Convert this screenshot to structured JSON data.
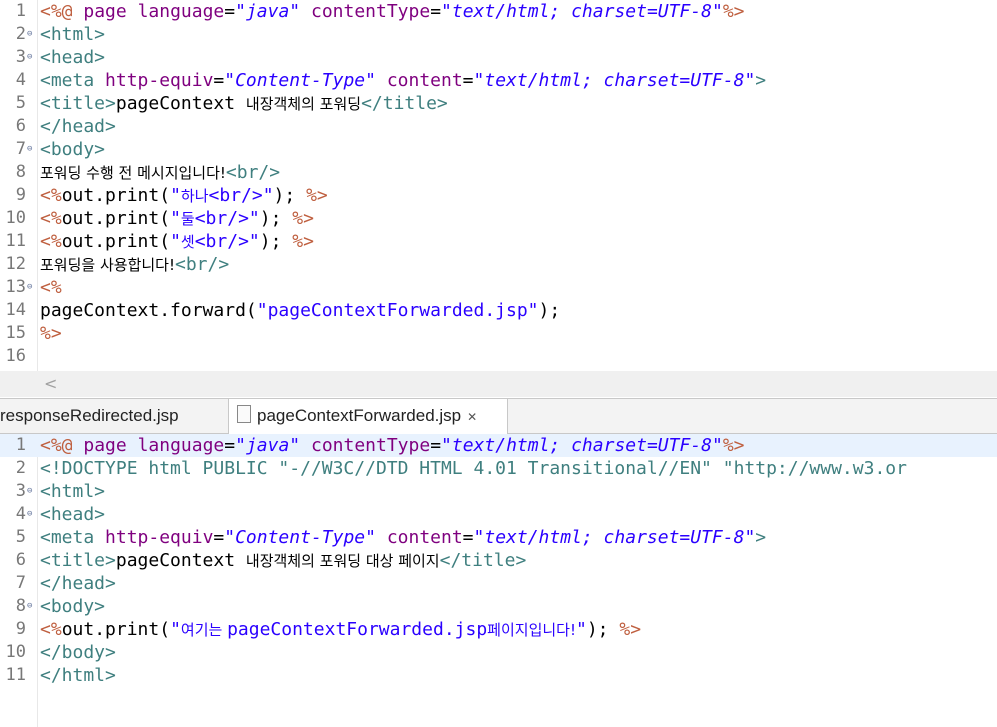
{
  "editor1": {
    "lines": [
      {
        "n": "1",
        "fold": "",
        "html": "<span class='jsp'>&lt;%@</span> <span class='attr'>page</span> <span class='attr'>language</span>=<span class='val'>\"java\"</span> <span class='attr'>contentType</span>=<span class='val'>\"text/html; charset=UTF-8\"</span><span class='jsp'>%&gt;</span>"
      },
      {
        "n": "2",
        "fold": "⊖",
        "html": "<span class='tag'>&lt;html&gt;</span>"
      },
      {
        "n": "3",
        "fold": "⊖",
        "html": "<span class='tag'>&lt;head&gt;</span>"
      },
      {
        "n": "4",
        "fold": "",
        "html": "<span class='tag'>&lt;meta</span> <span class='attr'>http-equiv</span>=<span class='val'>\"Content-Type\"</span> <span class='attr'>content</span>=<span class='val'>\"text/html; charset=UTF-8\"</span><span class='tag'>&gt;</span>"
      },
      {
        "n": "5",
        "fold": "",
        "html": "<span class='tag'>&lt;title&gt;</span><span class='txt'>pageContext </span><span class='txt kor'>내장객체의 포워딩</span><span class='tag'>&lt;/title&gt;</span>"
      },
      {
        "n": "6",
        "fold": "",
        "html": "<span class='tag'>&lt;/head&gt;</span>"
      },
      {
        "n": "7",
        "fold": "⊖",
        "html": "<span class='tag'>&lt;body&gt;</span>"
      },
      {
        "n": "8",
        "fold": "",
        "html": "<span class='txt kor'>포워딩 수행 전 메시지입니다!</span><span class='tag'>&lt;br/&gt;</span>"
      },
      {
        "n": "9",
        "fold": "",
        "html": "<span class='jsp'>&lt;%</span><span class='txt'>out.print(</span><span class='str'>\"</span><span class='str kor'>하나</span><span class='str'>&lt;br/&gt;\"</span><span class='txt'>); </span><span class='jsp'>%&gt;</span>"
      },
      {
        "n": "10",
        "fold": "",
        "html": "<span class='jsp'>&lt;%</span><span class='txt'>out.print(</span><span class='str'>\"</span><span class='str kor'>둘</span><span class='str'>&lt;br/&gt;\"</span><span class='txt'>); </span><span class='jsp'>%&gt;</span>"
      },
      {
        "n": "11",
        "fold": "",
        "html": "<span class='jsp'>&lt;%</span><span class='txt'>out.print(</span><span class='str'>\"</span><span class='str kor'>셋</span><span class='str'>&lt;br/&gt;\"</span><span class='txt'>); </span><span class='jsp'>%&gt;</span>"
      },
      {
        "n": "12",
        "fold": "",
        "html": "<span class='txt kor'>포워딩을 사용합니다!</span><span class='tag'>&lt;br/&gt;</span>"
      },
      {
        "n": "13",
        "fold": "⊖",
        "html": "<span class='jsp'>&lt;%</span>"
      },
      {
        "n": "14",
        "fold": "",
        "html": "<span class='txt'>pageContext.forward(</span><span class='str'>\"pageContextForwarded.jsp\"</span><span class='txt'>);</span>"
      },
      {
        "n": "15",
        "fold": "",
        "html": "<span class='jsp'>%&gt;</span>"
      },
      {
        "n": "16",
        "fold": "",
        "html": ""
      }
    ]
  },
  "scroll_arrow": "<",
  "tabs": {
    "inactive_label": "responseRedirected.jsp",
    "active_label": "pageContextForwarded.jsp",
    "close_glyph": "✕"
  },
  "editor2": {
    "lines": [
      {
        "n": "1",
        "fold": "",
        "hl": true,
        "html": "<span class='jsp'>&lt;%@</span> <span class='attr'>page</span> <span class='attr'>language</span>=<span class='val'>\"java\"</span> <span class='attr'>contentType</span>=<span class='val'>\"text/html; charset=UTF-8\"</span><span class='jsp'>%&gt;</span>"
      },
      {
        "n": "2",
        "fold": "",
        "html": "<span class='tag'>&lt;!DOCTYPE html PUBLIC \"-//W3C//DTD HTML 4.01 Transitional//EN\" \"http://www.w3.or</span>"
      },
      {
        "n": "3",
        "fold": "⊖",
        "html": "<span class='tag'>&lt;html&gt;</span>"
      },
      {
        "n": "4",
        "fold": "⊖",
        "html": "<span class='tag'>&lt;head&gt;</span>"
      },
      {
        "n": "5",
        "fold": "",
        "html": "<span class='tag'>&lt;meta</span> <span class='attr'>http-equiv</span>=<span class='val'>\"Content-Type\"</span> <span class='attr'>content</span>=<span class='val'>\"text/html; charset=UTF-8\"</span><span class='tag'>&gt;</span>"
      },
      {
        "n": "6",
        "fold": "",
        "html": "<span class='tag'>&lt;title&gt;</span><span class='txt'>pageContext </span><span class='txt kor'>내장객체의 포워딩 대상 페이지</span><span class='tag'>&lt;/title&gt;</span>"
      },
      {
        "n": "7",
        "fold": "",
        "html": "<span class='tag'>&lt;/head&gt;</span>"
      },
      {
        "n": "8",
        "fold": "⊖",
        "html": "<span class='tag'>&lt;body&gt;</span>"
      },
      {
        "n": "9",
        "fold": "",
        "html": "<span class='jsp'>&lt;%</span><span class='txt'>out.print(</span><span class='str'>\"</span><span class='str kor'>여기는 </span><span class='str'>pageContextForwarded.jsp</span><span class='str kor'>페이지입니다!</span><span class='str'>\"</span><span class='txt'>); </span><span class='jsp'>%&gt;</span>"
      },
      {
        "n": "10",
        "fold": "",
        "html": "<span class='tag'>&lt;/body&gt;</span>"
      },
      {
        "n": "11",
        "fold": "",
        "html": "<span class='tag'>&lt;/html&gt;</span>"
      }
    ]
  }
}
